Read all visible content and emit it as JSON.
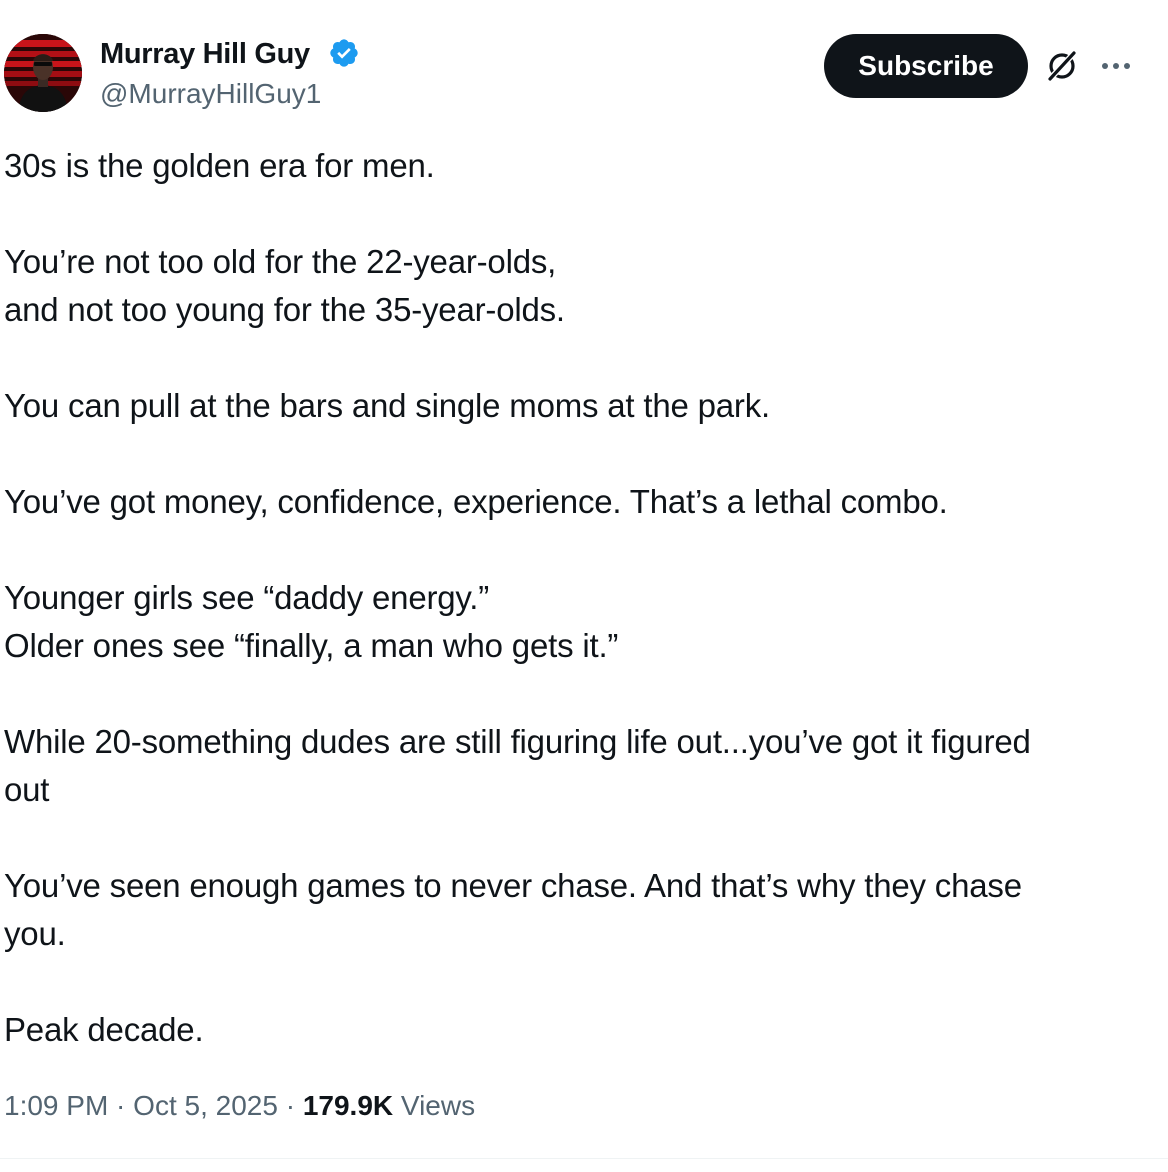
{
  "author": {
    "name": "Murray Hill Guy",
    "handle": "@MurrayHillGuy1",
    "verified": true,
    "avatar_icon": "profile-avatar",
    "verified_icon": "verified-badge-icon"
  },
  "actions": {
    "subscribe_label": "Subscribe",
    "grok_icon": "grok-icon",
    "more_icon": "more-options-icon"
  },
  "tweet": {
    "paragraphs": [
      "30s is the golden era for men.",
      "You’re not too old for the 22-year-olds,\nand not too young for the 35-year-olds.",
      "You can pull at the bars and single moms at the park.",
      "You’ve got money, confidence, experience. That’s a lethal combo.",
      "Younger girls see “daddy energy.”\nOlder ones see “finally, a man who gets it.”",
      "While 20-something dudes are still figuring life out...you’ve got it figured\nout",
      "You’ve seen enough games to never chase. And that’s why they chase\nyou.",
      "Peak decade."
    ]
  },
  "meta": {
    "time": "1:09 PM",
    "separator": " · ",
    "date": "Oct 5, 2025",
    "views_count": "179.9K",
    "views_label": "Views"
  },
  "colors": {
    "text_primary": "#0f1419",
    "text_secondary": "#536471",
    "verified_blue": "#1d9bf0",
    "subscribe_bg": "#0f1419",
    "avatar_red": "#c8141a"
  }
}
